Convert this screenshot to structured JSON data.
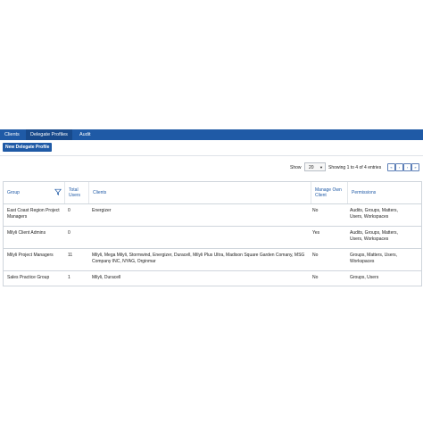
{
  "tabs": [
    {
      "label": "Clients"
    },
    {
      "label": "Delegate Profiles"
    },
    {
      "label": "Audit"
    }
  ],
  "toolbar": {
    "new_button_label": "New Delegate Profile"
  },
  "paging": {
    "show_label": "Show",
    "page_size": "20",
    "showing_text": "Showing 1 to 4 of 4 entries",
    "buttons": [
      "«",
      "‹",
      "›",
      "»"
    ]
  },
  "table": {
    "headers": {
      "group": "Group",
      "total_users": "Total Users",
      "clients": "Clients",
      "manage_own_client": "Manage Own Client",
      "permissions": "Permissions"
    },
    "rows": [
      {
        "group": "East Coast Region Project Managers",
        "total_users": "0",
        "clients": "Energizer",
        "manage_own_client": "No",
        "permissions": "Audits, Groups, Matters, Users, Workspaces"
      },
      {
        "group": "Milyli Client Admins",
        "total_users": "0",
        "clients": "",
        "manage_own_client": "Yes",
        "permissions": "Audits, Groups, Matters, Users, Workspaces"
      },
      {
        "group": "Milyli Project Managers",
        "total_users": "11",
        "clients": "Milyli, Mega Milyli, Stormwind, Energizer, Duracell, Milyli Plus Ultra, Madison Square Garden Comany, MSG Company INC, NYAG, Orginmar",
        "manage_own_client": "No",
        "permissions": "Groups, Matters, Users, Workspaces"
      },
      {
        "group": "Sales Practice Group",
        "total_users": "1",
        "clients": "Milyli, Duracell",
        "manage_own_client": "No",
        "permissions": "Groups, Users"
      }
    ]
  },
  "colors": {
    "brand": "#1f5aa6",
    "brand_dark": "#184a8c",
    "border": "#cfd5dc"
  },
  "icons": {
    "filter": "filter-icon",
    "select_caret": "chevron-down-icon"
  }
}
